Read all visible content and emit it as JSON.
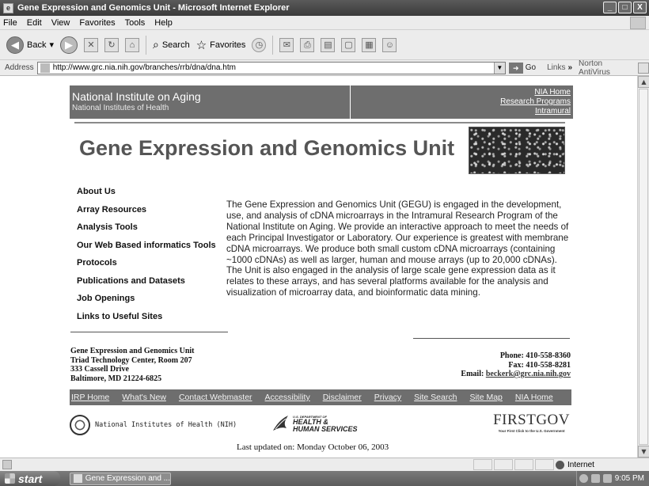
{
  "window": {
    "title": "Gene Expression and Genomics Unit - Microsoft Internet Explorer",
    "controls": [
      "_",
      "□",
      "X"
    ]
  },
  "menubar": {
    "items": [
      "File",
      "Edit",
      "View",
      "Favorites",
      "Tools",
      "Help"
    ]
  },
  "toolbar": {
    "back_label": "Back",
    "search_label": "Search",
    "favorites_label": "Favorites"
  },
  "address": {
    "label": "Address",
    "url": "http://www.grc.nia.nih.gov/branches/rrb/dna/dna.htm",
    "go_label": "Go",
    "links_label": "Links",
    "chevron": "»",
    "antivirus_label": "Norton AntiVirus"
  },
  "header": {
    "org_title": "National Institute on Aging",
    "org_subtitle": "National Institutes of Health",
    "links": [
      "NIA Home",
      "Research Programs",
      "Intramural"
    ]
  },
  "banner": {
    "title": "Gene Expression and Genomics Unit"
  },
  "leftnav": {
    "items": [
      "About Us",
      "Array Resources",
      "Analysis Tools",
      "Our Web Based informatics Tools",
      "Protocols",
      "Publications and Datasets",
      "Job Openings",
      "Links to Useful Sites"
    ]
  },
  "intro": {
    "text": "The Gene Expression and Genomics Unit (GEGU) is engaged in the development, use, and analysis of cDNA microarrays in the Intramural Research Program of the National Institute on Aging. We provide an interactive approach to meet the needs of each Principal Investigator or Laboratory. Our experience is greatest with membrane cDNA microarrays. We produce both small custom cDNA microarrays (containing ~1000 cDNAs) as well as larger, human and mouse arrays (up to 20,000 cDNAs). The Unit is also engaged in the analysis of large scale gene expression data as it relates to these arrays, and has several platforms available for the analysis and visualization of microarray data, and bioinformatic data mining."
  },
  "address_block": {
    "line1": "Gene Expression and Genomics Unit",
    "line2": "Triad Technology Center, Room 207",
    "line3": "333 Cassell Drive",
    "line4": "Baltimore, MD 21224-6825"
  },
  "contact": {
    "phone": "Phone: 410-558-8360",
    "fax": "Fax: 410-558-8281",
    "email_label": "Email:",
    "email": "beckerk@grc.nia.nih.gov"
  },
  "footer_nav": {
    "items": [
      "IRP Home",
      "What's New",
      "Contact Webmaster",
      "Accessibility",
      "Disclaimer",
      "Privacy",
      "Site Search",
      "Site Map",
      "NIA Home"
    ]
  },
  "logos": {
    "nih_label": "National Institutes of Health (NIH)",
    "hhs_small": "U.S. DEPARTMENT OF",
    "hhs_line1": "HEALTH &",
    "hhs_line2": "HUMAN SERVICES",
    "firstgov": "FIRSTGOV",
    "firstgov_tagline": "Your First Click to the U.S. Government"
  },
  "updated": "Last updated on: Monday October 06, 2003",
  "statusbar": {
    "zone": "Internet"
  },
  "taskbar": {
    "start": "start",
    "task": "Gene Expression and ...",
    "clock": "9:05 PM"
  }
}
